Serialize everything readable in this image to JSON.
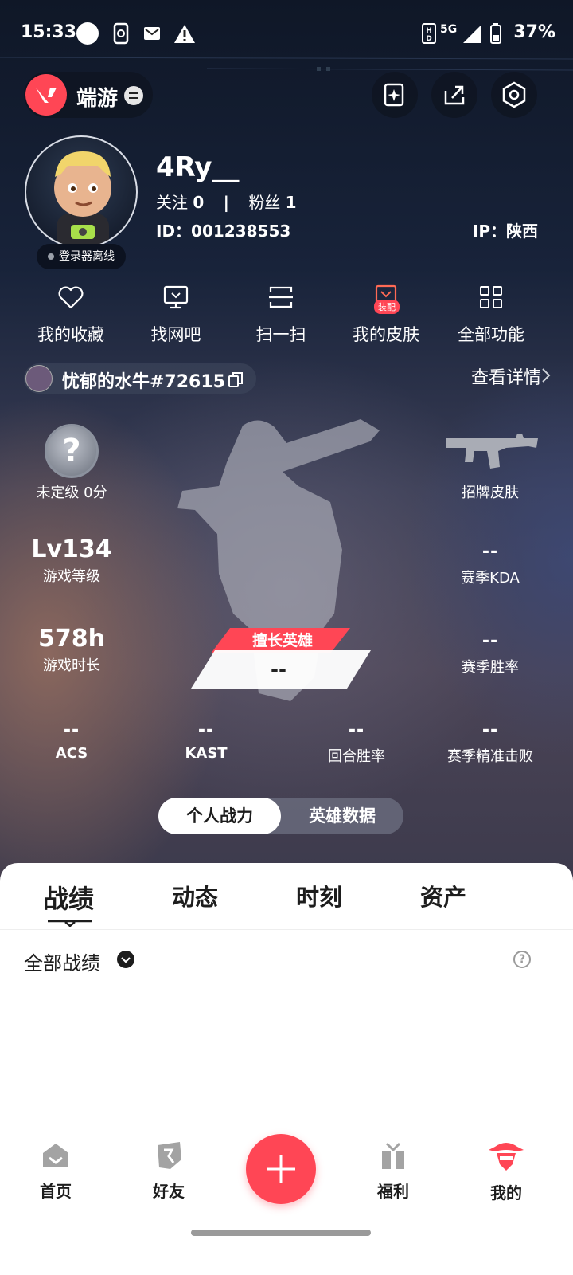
{
  "status_bar": {
    "time": "15:33",
    "network": "5G",
    "battery": "37%"
  },
  "header": {
    "app_name": "端游"
  },
  "profile": {
    "nickname": "4Ry__",
    "follow_label": "关注",
    "follow_count": "0",
    "fans_label": "粉丝",
    "fans_count": "1",
    "id_text": "ID：001238553",
    "ip_text": "IP：陕西",
    "login_status": "登录器离线"
  },
  "functions": [
    {
      "label": "我的收藏",
      "icon": "heart-icon"
    },
    {
      "label": "找网吧",
      "icon": "monitor-icon"
    },
    {
      "label": "扫一扫",
      "icon": "scan-icon"
    },
    {
      "label": "我的皮肤",
      "icon": "skin-icon",
      "tag": "装配"
    },
    {
      "label": "全部功能",
      "icon": "grid-icon"
    }
  ],
  "riot_account": {
    "name": "忧郁的水牛#72615",
    "detail_link": "查看详情"
  },
  "stats": {
    "rank_symbol": "?",
    "rank_label": "未定级 0分",
    "skin_label": "招牌皮肤",
    "level_value": "Lv134",
    "level_label": "游戏等级",
    "kda_value": "--",
    "kda_label": "赛季KDA",
    "playtime_value": "578h",
    "playtime_label": "游戏时长",
    "winrate_value": "--",
    "winrate_label": "赛季胜率",
    "best_hero_label": "擅长英雄",
    "best_hero_value": "--",
    "acs_value": "--",
    "acs_label": "ACS",
    "kast_value": "--",
    "kast_label": "KAST",
    "round_win_value": "--",
    "round_win_label": "回合胜率",
    "precise_kill_value": "--",
    "precise_kill_label": "赛季精准击败"
  },
  "toggle": {
    "active": "个人战力",
    "inactive": "英雄数据"
  },
  "tabs": [
    "战绩",
    "动态",
    "时刻",
    "资产"
  ],
  "records": {
    "filter_label": "全部战绩",
    "help_symbol": "?"
  },
  "bottom_nav": [
    {
      "label": "首页",
      "icon": "home-icon"
    },
    {
      "label": "好友",
      "icon": "friends-icon"
    },
    {
      "label": "福利",
      "icon": "gift-icon"
    },
    {
      "label": "我的",
      "icon": "profile-icon"
    }
  ],
  "colors": {
    "accent": "#ff4655",
    "text_dark": "#1d1d1d"
  }
}
